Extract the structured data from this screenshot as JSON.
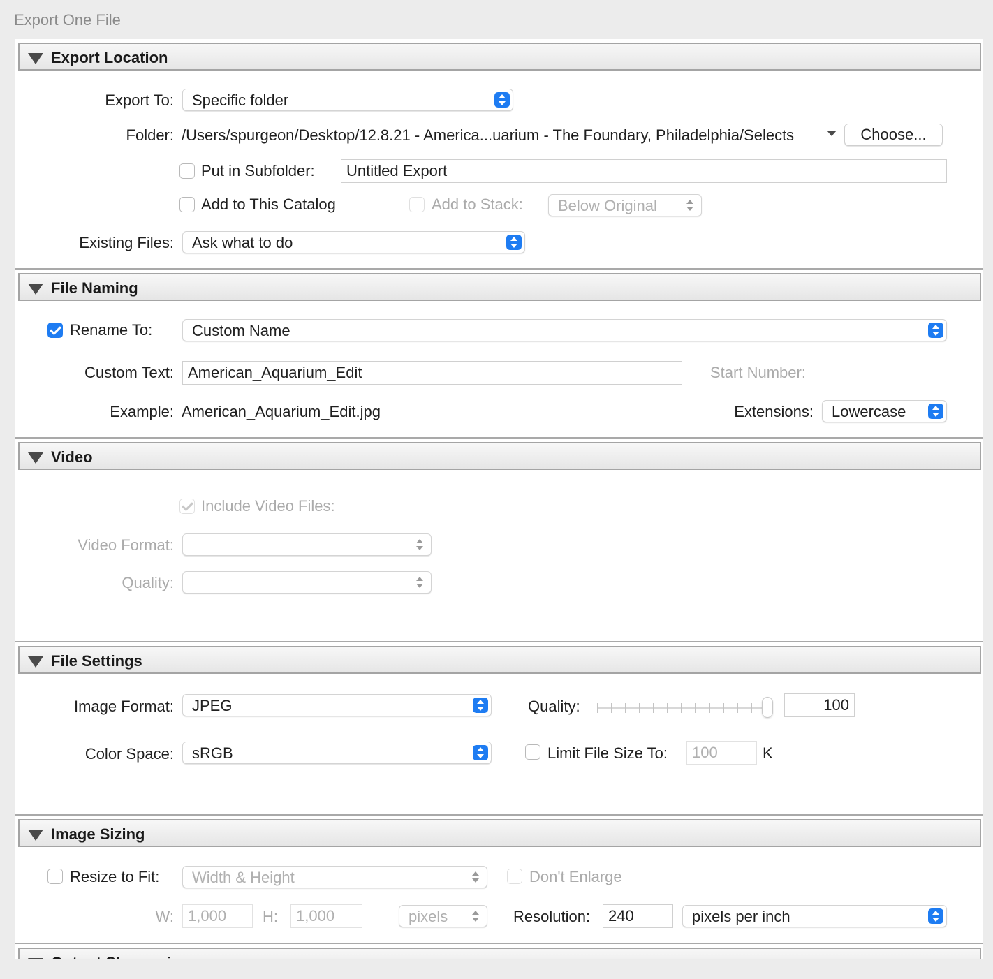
{
  "window": {
    "title": "Export One File"
  },
  "export_location": {
    "title": "Export Location",
    "export_to_label": "Export To:",
    "export_to_value": "Specific folder",
    "folder_label": "Folder:",
    "folder_path": "/Users/spurgeon/Desktop/12.8.21 - America...uarium - The Foundary, Philadelphia/Selects",
    "choose_label": "Choose...",
    "subfolder_label": "Put in Subfolder:",
    "subfolder_value": "Untitled Export",
    "add_catalog_label": "Add to This Catalog",
    "add_stack_label": "Add to Stack:",
    "add_stack_value": "Below Original",
    "existing_files_label": "Existing Files:",
    "existing_files_value": "Ask what to do"
  },
  "file_naming": {
    "title": "File Naming",
    "rename_label": "Rename To:",
    "rename_value": "Custom Name",
    "custom_text_label": "Custom Text:",
    "custom_text_value": "American_Aquarium_Edit",
    "start_number_label": "Start Number:",
    "example_label": "Example:",
    "example_value": "American_Aquarium_Edit.jpg",
    "extensions_label": "Extensions:",
    "extensions_value": "Lowercase"
  },
  "video": {
    "title": "Video",
    "include_label": "Include Video Files:",
    "format_label": "Video Format:",
    "quality_label": "Quality:"
  },
  "file_settings": {
    "title": "File Settings",
    "image_format_label": "Image Format:",
    "image_format_value": "JPEG",
    "quality_label": "Quality:",
    "quality_value": "100",
    "color_space_label": "Color Space:",
    "color_space_value": "sRGB",
    "limit_label": "Limit File Size To:",
    "limit_value": "100",
    "limit_unit": "K"
  },
  "image_sizing": {
    "title": "Image Sizing",
    "resize_label": "Resize to Fit:",
    "resize_value": "Width & Height",
    "dont_enlarge_label": "Don't Enlarge",
    "w_label": "W:",
    "w_value": "1,000",
    "h_label": "H:",
    "h_value": "1,000",
    "unit_value": "pixels",
    "resolution_label": "Resolution:",
    "resolution_value": "240",
    "resolution_unit": "pixels per inch"
  },
  "output_sharpening": {
    "title": "Output Sharpening"
  },
  "colors": {
    "accent": "#1e7cf2",
    "panel_bg": "#ffffff",
    "window_bg": "#ececec"
  }
}
